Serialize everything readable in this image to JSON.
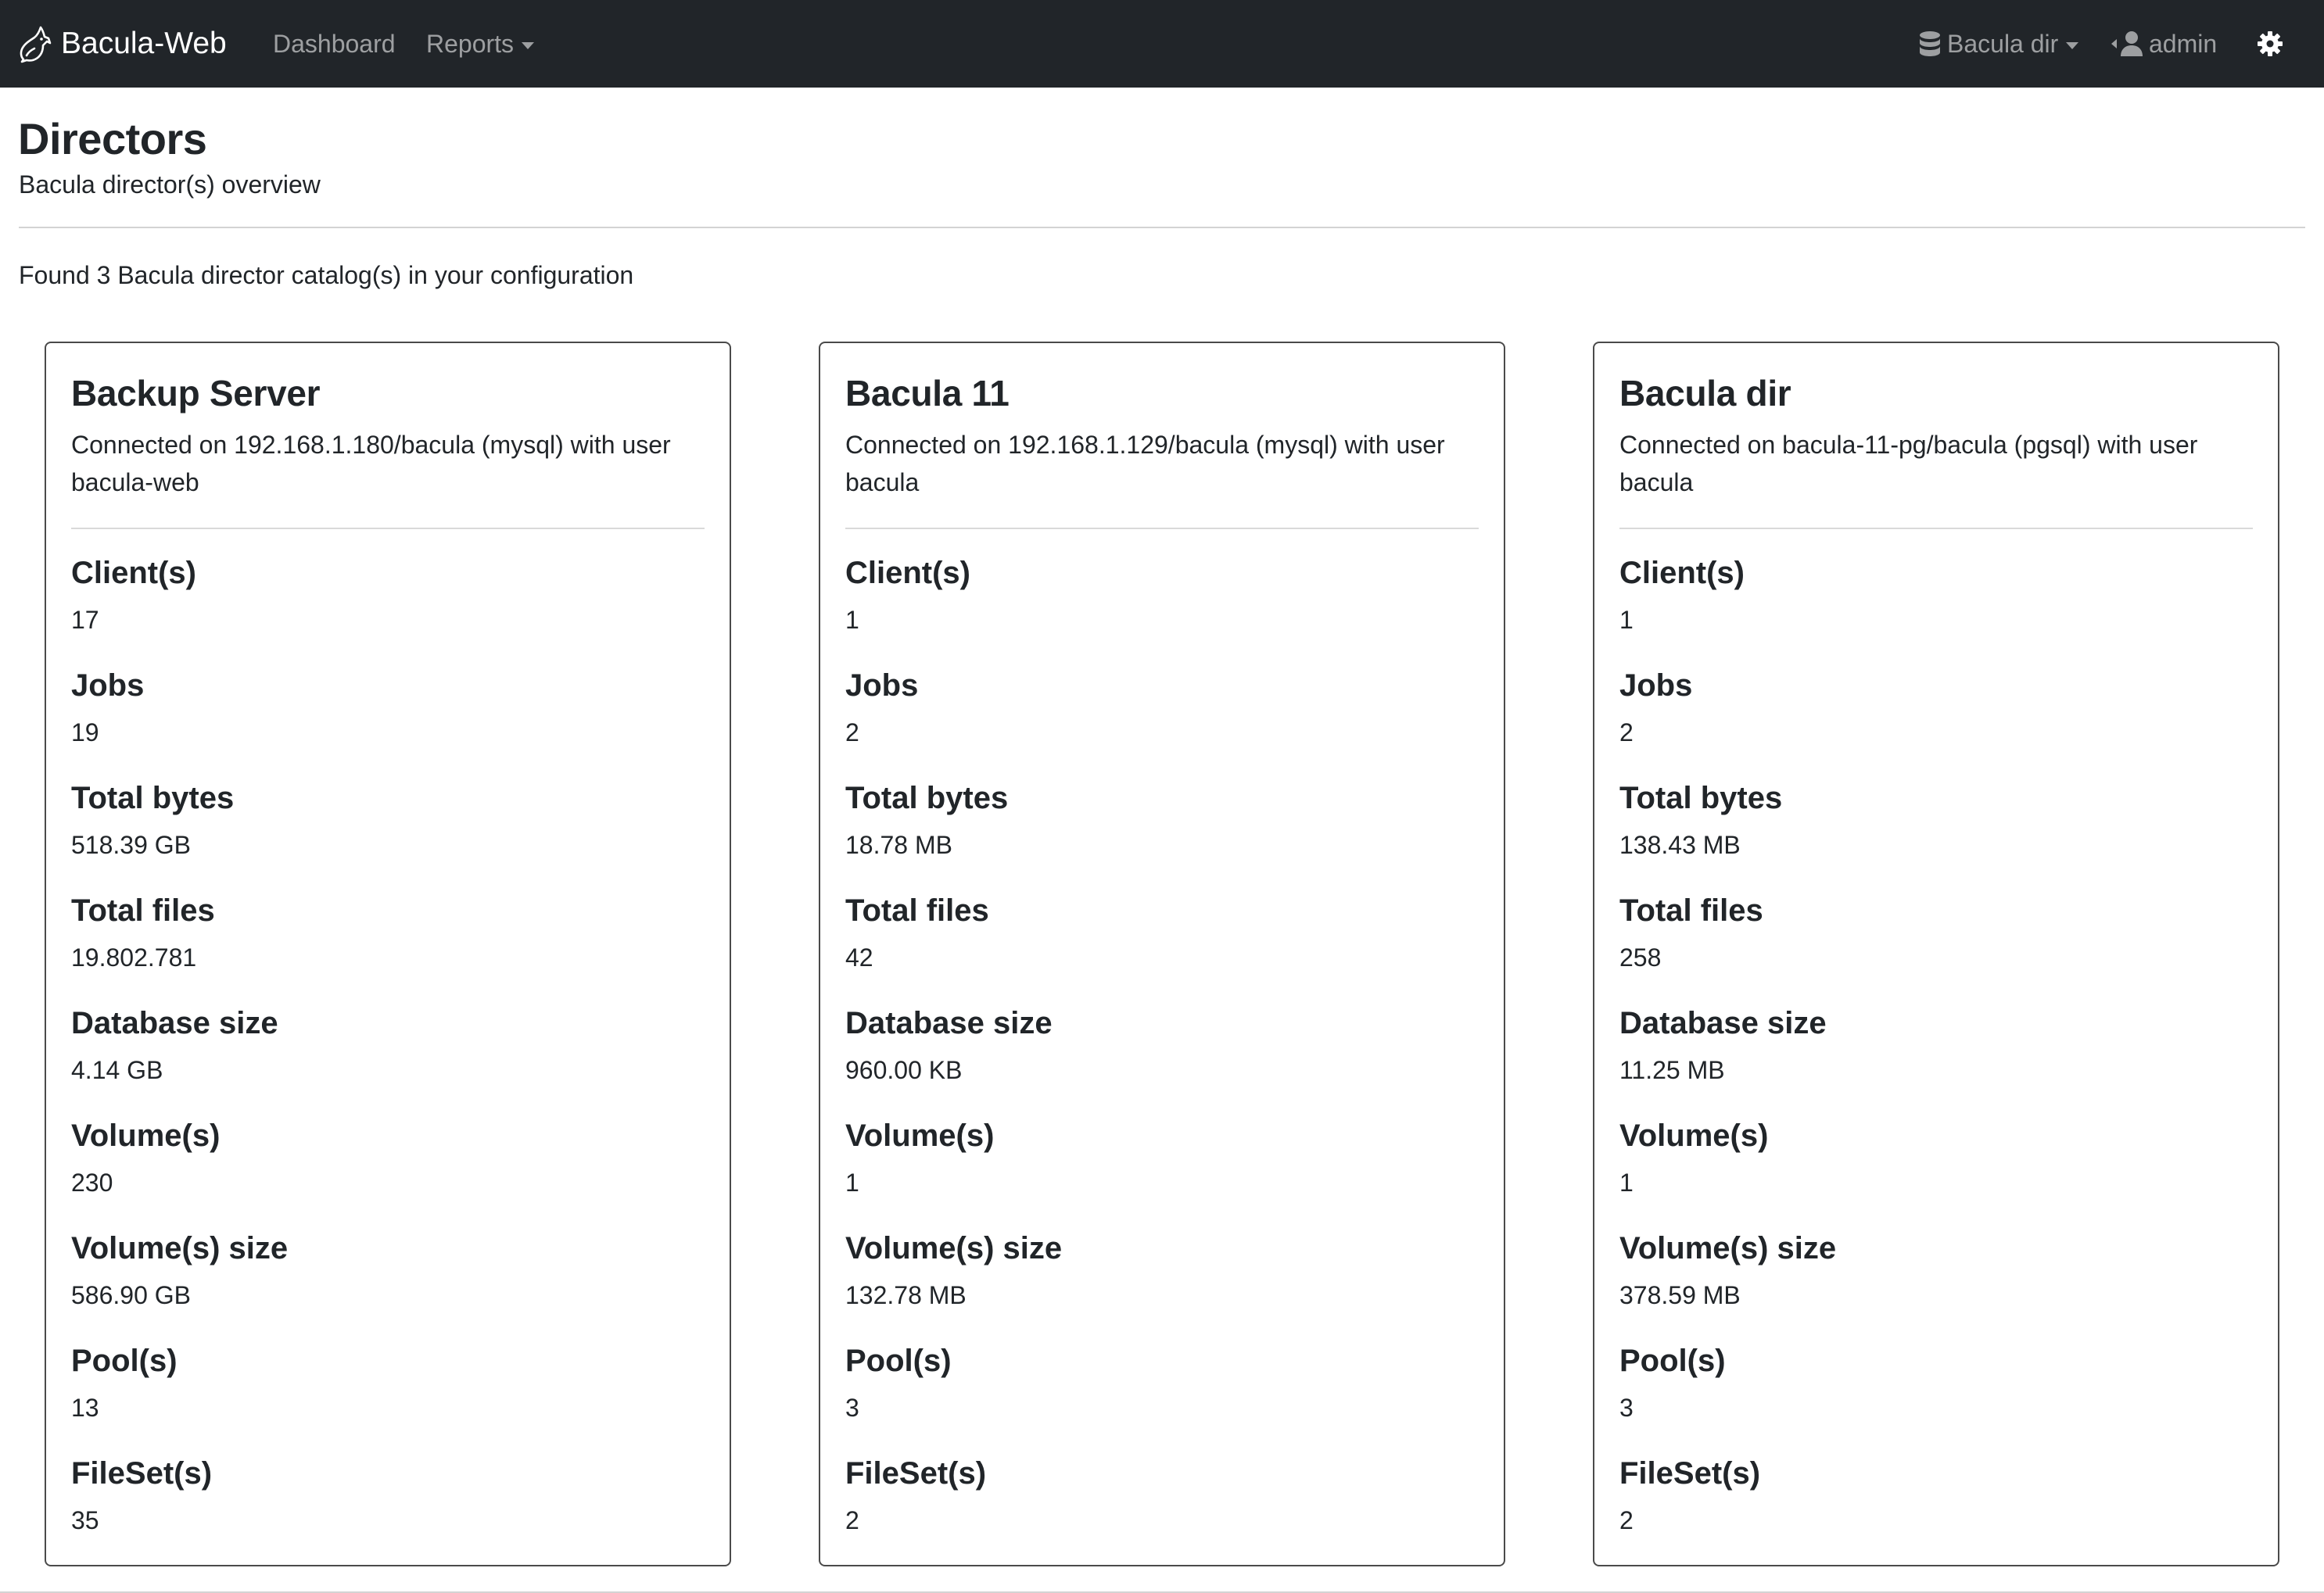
{
  "navbar": {
    "brand": "Bacula-Web",
    "dashboard": "Dashboard",
    "reports": "Reports",
    "catalog": "Bacula dir",
    "user": "admin",
    "icons": [
      "bacula-logo-icon",
      "database-icon",
      "user-icon",
      "gear-icon"
    ]
  },
  "header": {
    "title": "Directors",
    "subtitle": "Bacula director(s) overview",
    "found": "Found 3 Bacula director catalog(s) in your configuration"
  },
  "labels": {
    "clients": "Client(s)",
    "jobs": "Jobs",
    "total_bytes": "Total bytes",
    "total_files": "Total files",
    "database_size": "Database size",
    "volumes": "Volume(s)",
    "volumes_size": "Volume(s) size",
    "pools": "Pool(s)",
    "filesets": "FileSet(s)"
  },
  "directors": [
    {
      "name": "Backup Server",
      "connection": "Connected on 192.168.1.180/bacula (mysql) with user bacula-web",
      "clients": "17",
      "jobs": "19",
      "total_bytes": "518.39 GB",
      "total_files": "19.802.781",
      "database_size": "4.14 GB",
      "volumes": "230",
      "volumes_size": "586.90 GB",
      "pools": "13",
      "filesets": "35"
    },
    {
      "name": "Bacula 11",
      "connection": "Connected on 192.168.1.129/bacula (mysql) with user bacula",
      "clients": "1",
      "jobs": "2",
      "total_bytes": "18.78 MB",
      "total_files": "42",
      "database_size": "960.00 KB",
      "volumes": "1",
      "volumes_size": "132.78 MB",
      "pools": "3",
      "filesets": "2"
    },
    {
      "name": "Bacula dir",
      "connection": "Connected on bacula-11-pg/bacula (pgsql) with user bacula",
      "clients": "1",
      "jobs": "2",
      "total_bytes": "138.43 MB",
      "total_files": "258",
      "database_size": "11.25 MB",
      "volumes": "1",
      "volumes_size": "378.59 MB",
      "pools": "3",
      "filesets": "2"
    }
  ]
}
